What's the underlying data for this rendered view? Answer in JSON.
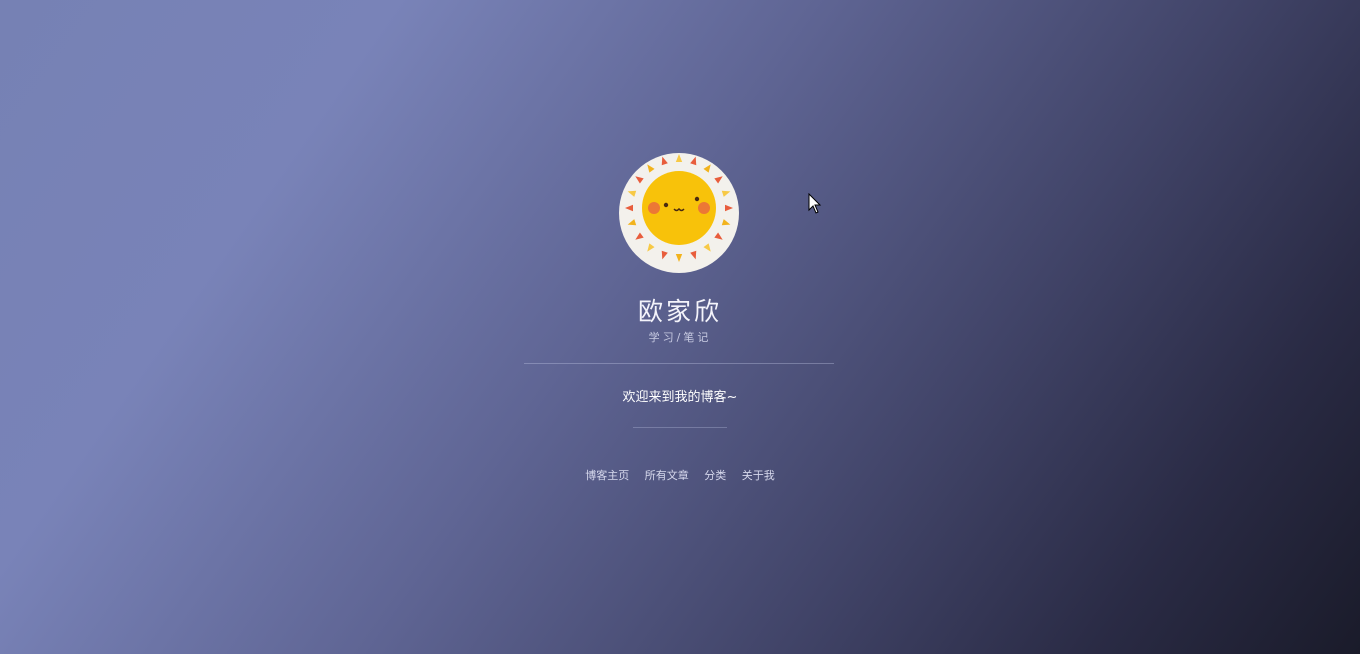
{
  "profile": {
    "name": "欧家欣",
    "subtitle": "学习/笔记",
    "avatar_icon": "sun-face-icon"
  },
  "welcome": {
    "text": "欢迎来到我的博客~"
  },
  "nav": {
    "items": [
      {
        "label": "博客主页"
      },
      {
        "label": "所有文章"
      },
      {
        "label": "分类"
      },
      {
        "label": "关于我"
      }
    ]
  },
  "colors": {
    "background_start": "#7983b8",
    "background_end": "#1a1b2a",
    "sun_face": "#f8c20a",
    "avatar_bg": "#f3f1ec"
  }
}
